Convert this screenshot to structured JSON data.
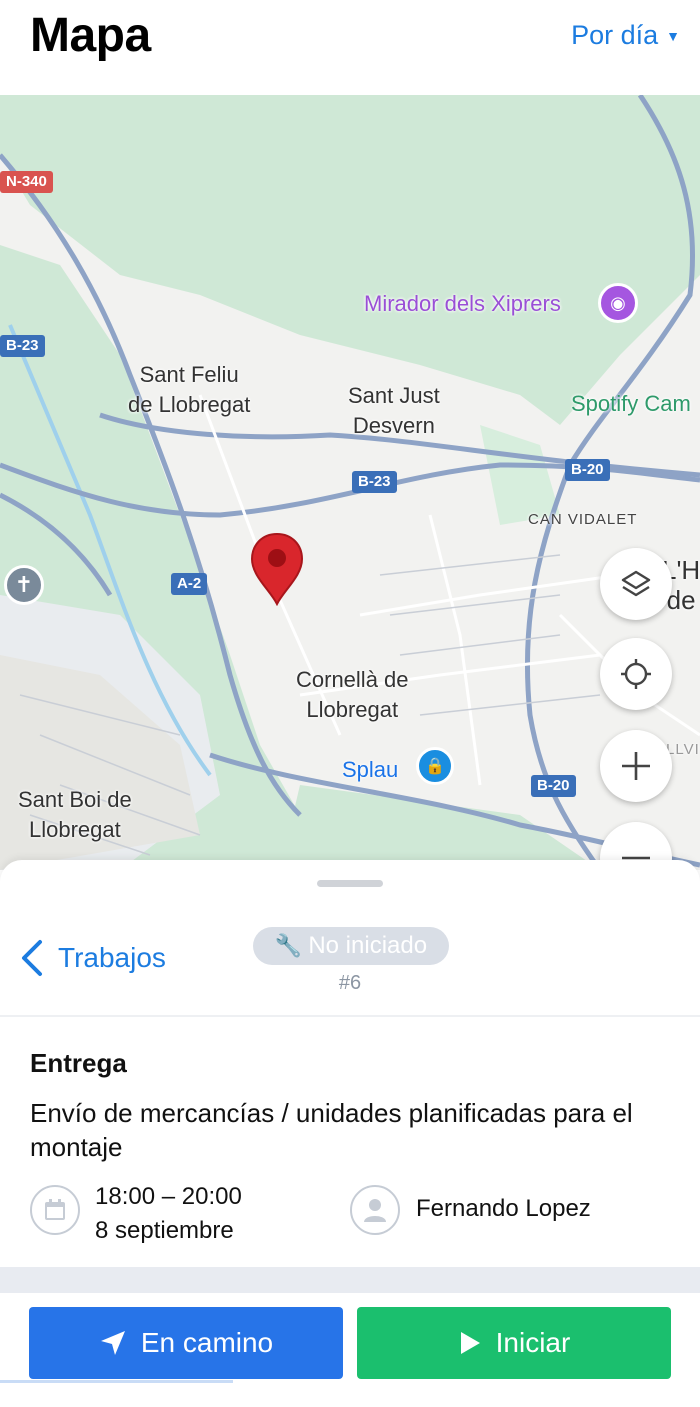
{
  "header": {
    "title": "Mapa",
    "filter_label": "Por día"
  },
  "map": {
    "labels": {
      "sant_feliu": "Sant Feliu\nde Llobregat",
      "sant_just": "Sant Just\nDesvern",
      "mirador": "Mirador dels Xiprers",
      "spotify": "Spotify Cam",
      "can_vidalet": "CAN VIDALET",
      "lh": "L'H\nde",
      "cornella": "Cornellà de\nLlobregat",
      "splau": "Splau",
      "sant_boi": "Sant Boi de\nLlobregat",
      "bellvi": "BELLVI"
    },
    "shields": {
      "n340": "N-340",
      "b23_left": "B-23",
      "b23_mid": "B-23",
      "b20_top": "B-20",
      "a2": "A-2",
      "b20_bottom": "B-20"
    },
    "controls": {
      "layers": "layers-icon",
      "locate": "my-location-icon",
      "zoom_in": "plus-icon",
      "zoom_out": "minus-icon"
    }
  },
  "job": {
    "back_label": "Trabajos",
    "status": "No iniciado",
    "number": "#6",
    "type": "Entrega",
    "description": "Envío de mercancías / unidades planificadas para el montaje",
    "time_range": "18:00 – 20:00",
    "date": "8 septiembre",
    "assignee": "Fernando Lopez"
  },
  "actions": {
    "en_camino": "En camino",
    "iniciar": "Iniciar"
  },
  "colors": {
    "accent": "#1c7ce0",
    "en_camino": "#2774e8",
    "iniciar": "#1bbf6e",
    "marker": "#d9262c"
  }
}
